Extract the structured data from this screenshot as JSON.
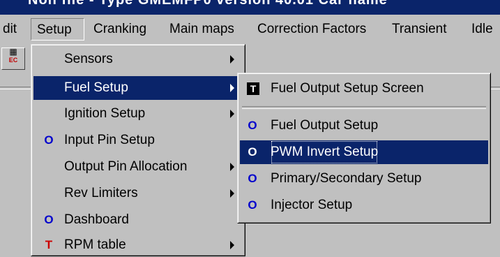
{
  "window": {
    "title": "Non file - Type GMEMFP0 version 40.01 Car name"
  },
  "menubar": {
    "items": [
      {
        "label": "dit"
      },
      {
        "label": "Setup",
        "active": true
      },
      {
        "label": "Cranking"
      },
      {
        "label": "Main maps"
      },
      {
        "label": "Correction Factors"
      },
      {
        "label": "Transient"
      },
      {
        "label": "Idle"
      }
    ]
  },
  "toolbar": {
    "button_text": "EC"
  },
  "setup_menu": {
    "items": [
      {
        "label": "Sensors",
        "icon": "",
        "submenu": true
      },
      {
        "label": "Fuel Setup",
        "icon": "",
        "submenu": true,
        "selected": true
      },
      {
        "label": "Ignition Setup",
        "icon": "",
        "submenu": true
      },
      {
        "label": "Input Pin Setup",
        "icon": "O",
        "submenu": false
      },
      {
        "label": "Output Pin Allocation",
        "icon": "",
        "submenu": true
      },
      {
        "label": "Rev Limiters",
        "icon": "",
        "submenu": true
      },
      {
        "label": "Dashboard",
        "icon": "O",
        "submenu": false
      },
      {
        "label": "RPM table",
        "icon": "T",
        "submenu": true
      }
    ]
  },
  "fuel_submenu": {
    "items": [
      {
        "label": "Fuel Output Setup Screen",
        "icon": "T"
      },
      {
        "label": "Fuel Output Setup",
        "icon": "O"
      },
      {
        "label": "PWM Invert Setup",
        "icon": "O",
        "selected": true
      },
      {
        "label": "Primary/Secondary Setup",
        "icon": "O"
      },
      {
        "label": "Injector Setup",
        "icon": "O"
      }
    ]
  },
  "colors": {
    "highlight": "#0a246a",
    "icon_blue": "#0000cc",
    "rpm_icon_red": "#cc0000"
  }
}
